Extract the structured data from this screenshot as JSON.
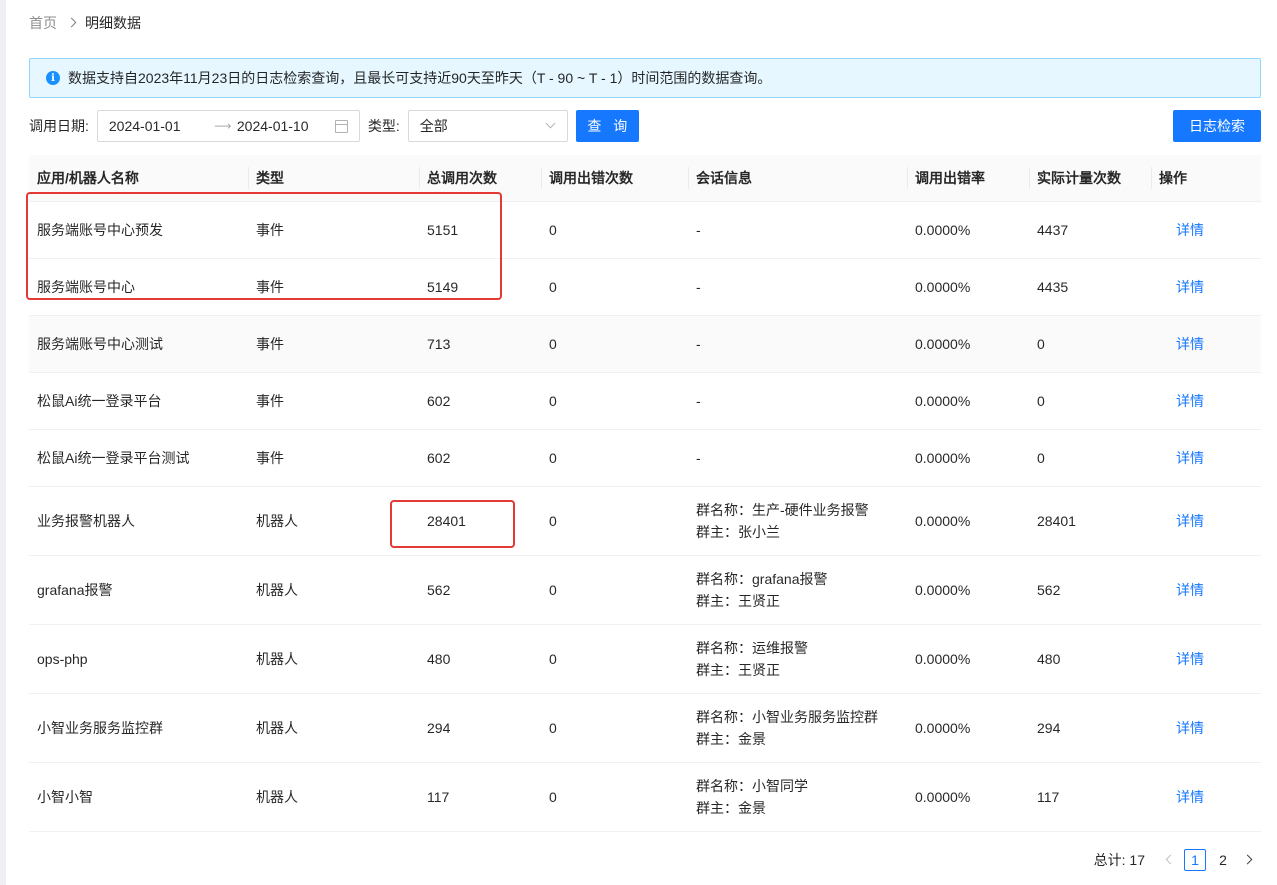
{
  "breadcrumb": {
    "home": "首页",
    "current": "明细数据"
  },
  "alert": {
    "text": "数据支持自2023年11月23日的日志检索查询，且最长可支持近90天至昨天（T - 90 ~ T - 1）时间范围的数据查询。"
  },
  "filter": {
    "date_label": "调用日期:",
    "date_start": "2024-01-01",
    "date_end": "2024-01-10",
    "type_label": "类型:",
    "type_value": "全部",
    "query_button": "查 询",
    "log_button": "日志检索"
  },
  "table": {
    "columns": [
      "应用/机器人名称",
      "类型",
      "总调用次数",
      "调用出错次数",
      "会话信息",
      "调用出错率",
      "实际计量次数",
      "操作"
    ],
    "rows": [
      {
        "name": "服务端账号中心预发",
        "type": "事件",
        "total": "5151",
        "errors": "0",
        "session": "-",
        "session2": "",
        "rate": "0.0000%",
        "actual": "4437",
        "op": "详情"
      },
      {
        "name": "服务端账号中心",
        "type": "事件",
        "total": "5149",
        "errors": "0",
        "session": "-",
        "session2": "",
        "rate": "0.0000%",
        "actual": "4435",
        "op": "详情"
      },
      {
        "name": "服务端账号中心测试",
        "type": "事件",
        "total": "713",
        "errors": "0",
        "session": "-",
        "session2": "",
        "rate": "0.0000%",
        "actual": "0",
        "op": "详情"
      },
      {
        "name": "松鼠Ai统一登录平台",
        "type": "事件",
        "total": "602",
        "errors": "0",
        "session": "-",
        "session2": "",
        "rate": "0.0000%",
        "actual": "0",
        "op": "详情"
      },
      {
        "name": "松鼠Ai统一登录平台测试",
        "type": "事件",
        "total": "602",
        "errors": "0",
        "session": "-",
        "session2": "",
        "rate": "0.0000%",
        "actual": "0",
        "op": "详情"
      },
      {
        "name": "业务报警机器人",
        "type": "机器人",
        "total": "28401",
        "errors": "0",
        "session": "群名称：生产-硬件业务报警",
        "session2": "群主：张小兰",
        "rate": "0.0000%",
        "actual": "28401",
        "op": "详情"
      },
      {
        "name": "grafana报警",
        "type": "机器人",
        "total": "562",
        "errors": "0",
        "session": "群名称：grafana报警",
        "session2": "群主：王贤正",
        "rate": "0.0000%",
        "actual": "562",
        "op": "详情"
      },
      {
        "name": "ops-php",
        "type": "机器人",
        "total": "480",
        "errors": "0",
        "session": "群名称：运维报警",
        "session2": "群主：王贤正",
        "rate": "0.0000%",
        "actual": "480",
        "op": "详情"
      },
      {
        "name": "小智业务服务监控群",
        "type": "机器人",
        "total": "294",
        "errors": "0",
        "session": "群名称：小智业务服务监控群",
        "session2": "群主：金景",
        "rate": "0.0000%",
        "actual": "294",
        "op": "详情"
      },
      {
        "name": "小智小智",
        "type": "机器人",
        "total": "117",
        "errors": "0",
        "session": "群名称：小智同学",
        "session2": "群主：金景",
        "rate": "0.0000%",
        "actual": "117",
        "op": "详情"
      }
    ]
  },
  "pagination": {
    "total_label": "总计:",
    "total": "17",
    "pages": [
      "1",
      "2"
    ],
    "current": "1"
  },
  "colors": {
    "primary": "#1677ff",
    "highlight": "#e53935",
    "alert_bg": "#e6f7ff"
  }
}
